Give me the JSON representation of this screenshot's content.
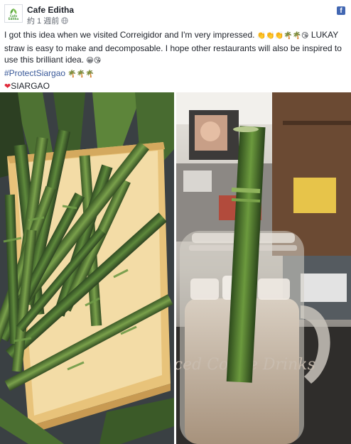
{
  "post": {
    "page_name": "Cafe Editha",
    "timestamp": "約 1 週前",
    "platform_badge": "f",
    "avatar_text": "Cafe Editha",
    "text": {
      "line1": "I got this idea when we visited Correigidor and I'm very impressed.",
      "line1_emoji": "👏👏👏🌴🌴😘",
      "line1_tail": " LUKAY",
      "line2": "straw is easy to make and decomposable. I hope other restaurants will also be inspired to",
      "line3": "use this brilliant idea.",
      "line3_emoji": "😀😘",
      "hashtag": "#ProtectSiargao",
      "hashtag_emoji": "🌴🌴🌴",
      "location_heart": "❤",
      "location": "SIARGAO"
    }
  },
  "photos": {
    "left": {
      "subject": "lukay-straws-in-bamboo-tray"
    },
    "right": {
      "subject": "iced-coffee-mason-jar-with-lukay-straw",
      "jar_lettering": "Iced Coffee Drinks"
    }
  },
  "colors": {
    "link": "#385898",
    "text": "#1d2129",
    "meta": "#616770",
    "facebook_blue": "#4267b2"
  }
}
